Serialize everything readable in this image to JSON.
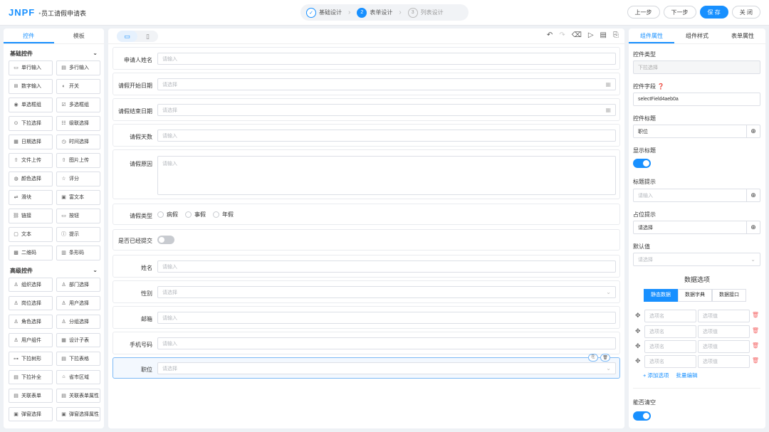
{
  "header": {
    "logo": "JNPF",
    "title": "员工请假申请表",
    "steps": [
      {
        "num": "✓",
        "label": "基础设计"
      },
      {
        "num": "2",
        "label": "表单设计"
      },
      {
        "num": "3",
        "label": "列表设计"
      }
    ],
    "actions": {
      "prev": "上一步",
      "next": "下一步",
      "save": "保 存",
      "close": "关 闭"
    }
  },
  "left": {
    "tabs": [
      "控件",
      "模板"
    ],
    "basic_title": "基础控件",
    "basic": [
      {
        "icon": "▭",
        "label": "单行输入"
      },
      {
        "icon": "▤",
        "label": "多行输入"
      },
      {
        "icon": "⊞",
        "label": "数字输入"
      },
      {
        "icon": "◐",
        "label": "开关"
      },
      {
        "icon": "◉",
        "label": "单选框组"
      },
      {
        "icon": "☑",
        "label": "多选框组"
      },
      {
        "icon": "⊙",
        "label": "下拉选择"
      },
      {
        "icon": "☷",
        "label": "级联选择"
      },
      {
        "icon": "▦",
        "label": "日期选择"
      },
      {
        "icon": "◷",
        "label": "时间选择"
      },
      {
        "icon": "⇧",
        "label": "文件上传"
      },
      {
        "icon": "⇧",
        "label": "图片上传"
      },
      {
        "icon": "◍",
        "label": "颜色选择"
      },
      {
        "icon": "☆",
        "label": "评分"
      },
      {
        "icon": "⇌",
        "label": "滑块"
      },
      {
        "icon": "▣",
        "label": "富文本"
      },
      {
        "icon": "⛓",
        "label": "链接"
      },
      {
        "icon": "▭",
        "label": "按钮"
      },
      {
        "icon": "▢",
        "label": "文本"
      },
      {
        "icon": "ⓘ",
        "label": "提示"
      },
      {
        "icon": "▩",
        "label": "二维码"
      },
      {
        "icon": "▥",
        "label": "条形码"
      }
    ],
    "advanced_title": "高级控件",
    "advanced": [
      {
        "icon": "♙",
        "label": "组织选择"
      },
      {
        "icon": "♙",
        "label": "部门选择"
      },
      {
        "icon": "♙",
        "label": "岗位选择"
      },
      {
        "icon": "♙",
        "label": "用户选择"
      },
      {
        "icon": "♙",
        "label": "角色选择"
      },
      {
        "icon": "♙",
        "label": "分组选择"
      },
      {
        "icon": "♙",
        "label": "用户组件"
      },
      {
        "icon": "▦",
        "label": "设计子表"
      },
      {
        "icon": "⊶",
        "label": "下拉树形"
      },
      {
        "icon": "▤",
        "label": "下拉表格"
      },
      {
        "icon": "▤",
        "label": "下拉补全"
      },
      {
        "icon": "⌂",
        "label": "省市区域"
      },
      {
        "icon": "▤",
        "label": "关联表单"
      },
      {
        "icon": "▤",
        "label": "关联表单属性"
      },
      {
        "icon": "▣",
        "label": "弹窗选择"
      },
      {
        "icon": "▣",
        "label": "弹窗选择属性"
      }
    ]
  },
  "form": {
    "fields": [
      {
        "label": "申请人姓名",
        "placeholder": "请输入"
      },
      {
        "label": "请假开始日期",
        "placeholder": "请选择"
      },
      {
        "label": "请假结束日期",
        "placeholder": "请选择"
      },
      {
        "label": "请假天数",
        "placeholder": "请输入"
      },
      {
        "label": "请假原因",
        "placeholder": "请输入"
      },
      {
        "label": "请假类型",
        "options": [
          "病假",
          "事假",
          "年假"
        ]
      },
      {
        "label": "是否已经提交"
      },
      {
        "label": "姓名",
        "placeholder": "请输入"
      },
      {
        "label": "性别",
        "placeholder": "请选择"
      },
      {
        "label": "邮箱",
        "placeholder": "请输入"
      },
      {
        "label": "手机号码",
        "placeholder": "请输入"
      },
      {
        "label": "职位",
        "placeholder": "请选择"
      }
    ]
  },
  "right": {
    "tabs": [
      "组件属性",
      "组件样式",
      "表单属性"
    ],
    "type_label": "控件类型",
    "type_value": "下拉选择",
    "field_label": "控件字段",
    "field_value": "selectField4aeb0a",
    "title_label": "控件标题",
    "title_value": "职位",
    "show_title_label": "显示标题",
    "tip_label": "标题提示",
    "tip_placeholder": "请输入",
    "ph_label": "占位提示",
    "ph_value": "请选择",
    "default_label": "默认值",
    "default_placeholder": "请选择",
    "data_title": "数据选项",
    "data_tabs": [
      "静态数据",
      "数据字典",
      "数据接口"
    ],
    "option_name_ph": "选项名",
    "option_value_ph": "选项值",
    "add_option": "+ 添加选项",
    "batch_edit": "批量编辑",
    "clearable_label": "能否清空"
  },
  "colors": {
    "accent": "#1890ff",
    "danger": "#f56c6c"
  }
}
